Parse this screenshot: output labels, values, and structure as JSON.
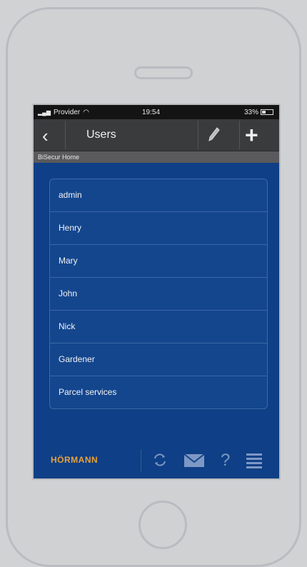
{
  "status": {
    "carrier": "Provider",
    "time": "19:54",
    "battery": "33%"
  },
  "navbar": {
    "title": "Users"
  },
  "breadcrumb": "BiSecur Home",
  "users": [
    "admin",
    "Henry",
    "Mary",
    "John",
    "Nick",
    "Gardener",
    "Parcel services"
  ],
  "footer": {
    "brand": "HÖRMANN",
    "help": "?"
  },
  "colors": {
    "screen": "#0f3f86",
    "navbar": "#3a3b3d",
    "brand": "#e8a23a"
  }
}
